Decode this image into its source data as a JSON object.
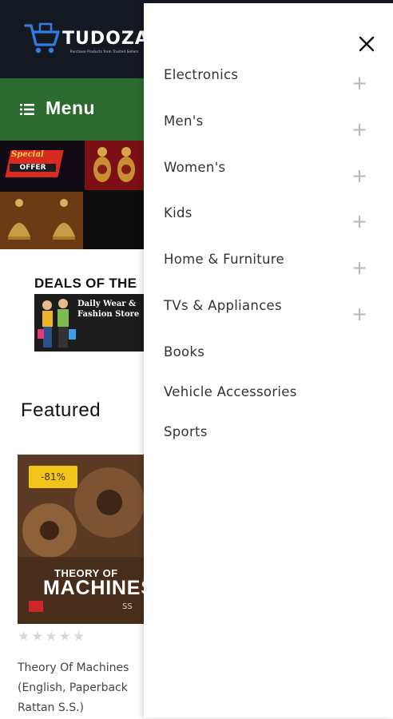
{
  "header": {
    "logo_text": "TUDOZA",
    "logo_tagline": "Purchase Products from Trusted Sellers"
  },
  "menu_bar": {
    "label": "Menu"
  },
  "banner": {
    "offer_line1": "Special",
    "offer_line2": "OFFER"
  },
  "deals": {
    "title": "DEALS OF THE",
    "banner_line1": "Daily Wear &",
    "banner_line2": "Fashion Store"
  },
  "featured": {
    "title": "Featured",
    "product": {
      "discount": "-81%",
      "cover_title_line1": "THEORY OF",
      "cover_title_line2": "MACHINES",
      "cover_author": "SS",
      "rating": 0,
      "max_rating": 5,
      "name_line1": "Theory Of Machines",
      "name_line2": "(English, Paperback",
      "name_line3": "Rattan S.S.)"
    }
  },
  "drawer": {
    "categories": [
      {
        "label": "Electronics",
        "expandable": true
      },
      {
        "label": "Men's",
        "expandable": true
      },
      {
        "label": "Women's",
        "expandable": true
      },
      {
        "label": "Kids",
        "expandable": true
      },
      {
        "label": "Home & Furniture",
        "expandable": true
      },
      {
        "label": "TVs & Appliances",
        "expandable": true
      },
      {
        "label": "Books",
        "expandable": false
      },
      {
        "label": "Vehicle Accessories",
        "expandable": false
      },
      {
        "label": "Sports",
        "expandable": false
      }
    ],
    "expand_glyph": "+"
  },
  "colors": {
    "header_bg": "#141821",
    "menu_bar_bg": "#2d6a2f",
    "discount_badge": "#f2c51b",
    "drawer_text": "#333333",
    "plus_icon": "#b6b6b6"
  }
}
